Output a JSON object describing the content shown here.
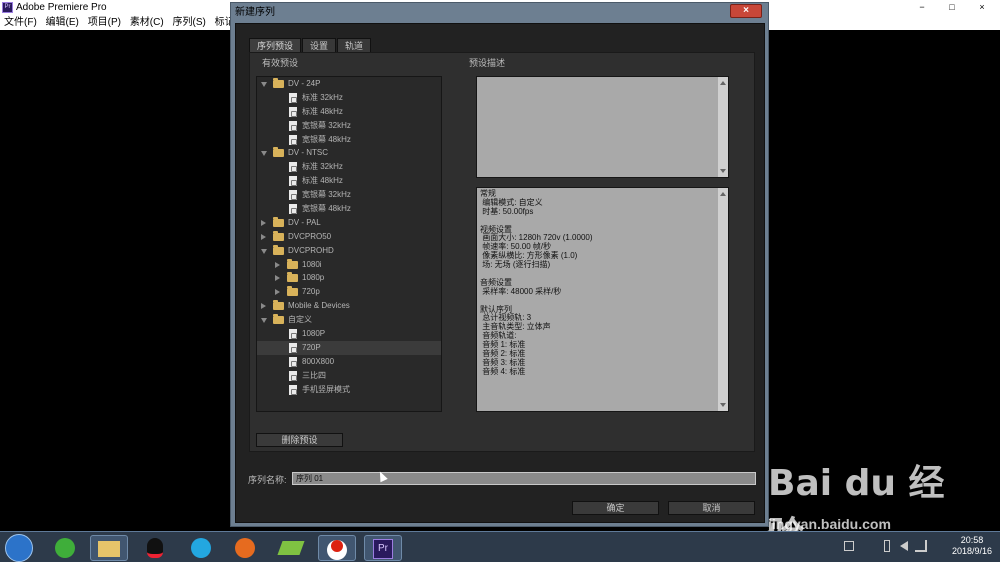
{
  "app": {
    "title": "Adobe Premiere Pro",
    "logo_text": "Pr",
    "window_controls": [
      "−",
      "□",
      "×"
    ]
  },
  "menubar": [
    "文件(F)",
    "编辑(E)",
    "项目(P)",
    "素材(C)",
    "序列(S)",
    "标记(M"
  ],
  "dialog": {
    "title": "新建序列",
    "close": "×",
    "tabs": [
      "序列预设",
      "设置",
      "轨道"
    ],
    "available_presets_label": "有效预设",
    "preset_description_label": "预设描述",
    "tree": [
      {
        "level": 0,
        "type": "folder",
        "expanded": true,
        "label": "DV - 24P"
      },
      {
        "level": 1,
        "type": "file",
        "label": "标准 32kHz"
      },
      {
        "level": 1,
        "type": "file",
        "label": "标准 48kHz"
      },
      {
        "level": 1,
        "type": "file",
        "label": "宽银幕 32kHz"
      },
      {
        "level": 1,
        "type": "file",
        "label": "宽银幕 48kHz"
      },
      {
        "level": 0,
        "type": "folder",
        "expanded": true,
        "label": "DV - NTSC"
      },
      {
        "level": 1,
        "type": "file",
        "label": "标准 32kHz"
      },
      {
        "level": 1,
        "type": "file",
        "label": "标准 48kHz"
      },
      {
        "level": 1,
        "type": "file",
        "label": "宽银幕 32kHz"
      },
      {
        "level": 1,
        "type": "file",
        "label": "宽银幕 48kHz"
      },
      {
        "level": 0,
        "type": "folder",
        "expanded": false,
        "label": "DV - PAL"
      },
      {
        "level": 0,
        "type": "folder",
        "expanded": false,
        "label": "DVCPRO50"
      },
      {
        "level": 0,
        "type": "folder",
        "expanded": true,
        "label": "DVCPROHD"
      },
      {
        "level": 1,
        "type": "folder",
        "expanded": false,
        "label": "1080i"
      },
      {
        "level": 1,
        "type": "folder",
        "expanded": false,
        "label": "1080p"
      },
      {
        "level": 1,
        "type": "folder",
        "expanded": false,
        "label": "720p"
      },
      {
        "level": 0,
        "type": "folder",
        "expanded": false,
        "label": "Mobile & Devices"
      },
      {
        "level": 0,
        "type": "folder",
        "expanded": true,
        "label": "自定义"
      },
      {
        "level": 1,
        "type": "file",
        "label": "1080P"
      },
      {
        "level": 1,
        "type": "file",
        "label": "720P",
        "selected": true
      },
      {
        "level": 1,
        "type": "file",
        "label": "800X800"
      },
      {
        "level": 1,
        "type": "file",
        "label": "三比四"
      },
      {
        "level": 1,
        "type": "file",
        "label": "手机竖屏模式"
      }
    ],
    "description_lines": [
      "常规",
      " 编辑模式: 自定义",
      " 时基: 50.00fps",
      "",
      "视频设置",
      " 画面大小: 1280h 720v (1.0000)",
      " 帧速率: 50.00 帧/秒",
      " 像素纵横比: 方形像素 (1.0)",
      " 场: 无场 (逐行扫描)",
      "",
      "音频设置",
      " 采样率: 48000 采样/秒",
      "",
      "默认序列",
      " 总计视频轨: 3",
      " 主音轨类型: 立体声",
      " 音频轨道:",
      " 音频 1: 标准",
      " 音频 2: 标准",
      " 音频 3: 标准",
      " 音频 4: 标准"
    ],
    "delete_preset_button": "删除预设",
    "sequence_name_label": "序列名称:",
    "sequence_name_value": "序列 01",
    "ok_button": "确定",
    "cancel_button": "取消"
  },
  "taskbar": {
    "clock_time": "20:58",
    "clock_date": "2018/9/16",
    "apps": [
      "windows-start",
      "360-browser",
      "file-explorer",
      "qq",
      "media-player",
      "firefox",
      "tool-app",
      "recorder",
      "premiere-pro"
    ],
    "premiere_label": "Pr"
  },
  "watermark": {
    "logo": "Bai du 经验",
    "url": "jingyan.baidu.com"
  }
}
